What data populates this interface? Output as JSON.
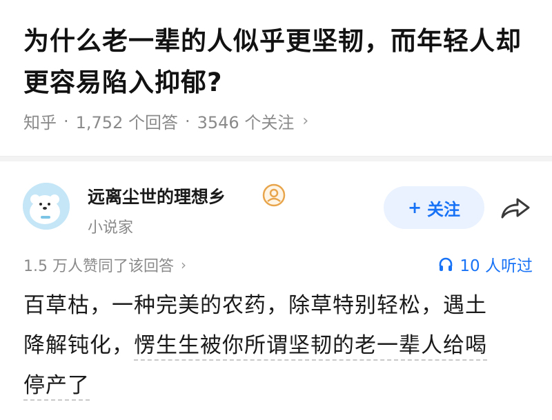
{
  "question": {
    "title": "为什么老一辈的人似乎更坚韧，而年轻人却更容易陷入抑郁?",
    "source": "知乎",
    "sep": "·",
    "answers": "1,752 个回答",
    "follows": "3546 个关注",
    "chevron": "›"
  },
  "author": {
    "name": "远离尘世的理想乡",
    "desc": "小说家",
    "avatar_icon": "polar-bear-avatar",
    "badge_icon": "creator-badge-icon"
  },
  "actions": {
    "follow_label": "关注",
    "follow_plus": "+",
    "share_icon": "share-arrow-icon"
  },
  "stats": {
    "votes": "1.5 万人赞同了该回答",
    "listen": "10 人听过"
  },
  "answer": {
    "line1": "百草枯，一种完美的农药，除草特别轻松，遇土",
    "line2_a": "降解钝化，",
    "line2_b": "愣生生被你所谓坚韧的老一辈人给喝",
    "line3": "停产了"
  },
  "colors": {
    "accent": "#1772f6",
    "follow_bg": "#eaf2ff",
    "meta": "#8a8a8a",
    "text": "#1a1a1a"
  }
}
